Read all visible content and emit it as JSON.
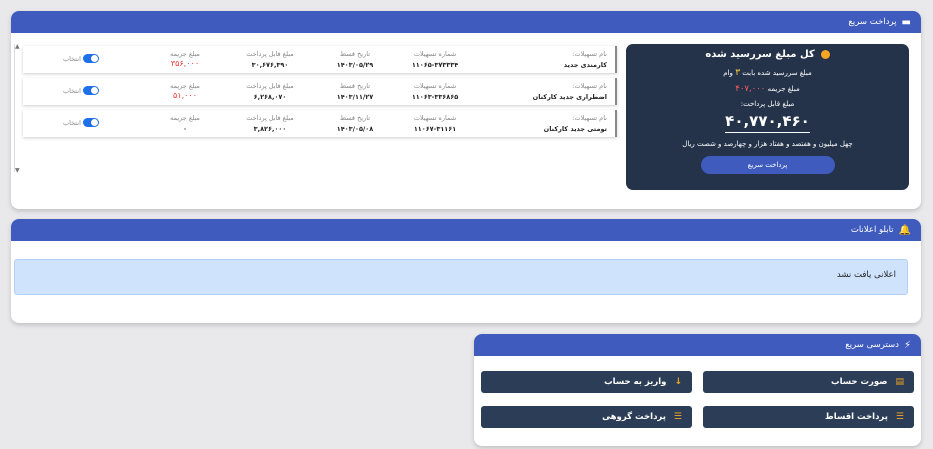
{
  "fast_payment": {
    "title": "پرداخت سریع",
    "summary": {
      "title": "کل مبلغ سررسید شده",
      "overdue_prefix": "مبلغ سررسید شده بابت",
      "overdue_count": "۳",
      "overdue_suffix": "وام",
      "fine_label": "مبلغ جریمه",
      "fine_amount": "۴۰۷,۰۰۰",
      "payable_label": "مبلغ قابل پرداخت:",
      "payable_amount": "۴۰,۷۷۰,۴۶۰",
      "amount_words": "چهل میلیون و هفتصد و هفتاد هزار و چهارصد و شصت ریال",
      "button": "پرداخت سریع"
    },
    "labels": {
      "name": "نام تسهیلات:",
      "number": "شماره تسهیلات",
      "date": "تاریخ قسط",
      "payable": "مبلغ قابل پرداخت",
      "fine": "مبلغ جریمه",
      "select": "انتخاب"
    },
    "loans": [
      {
        "name": "کارمندی جدید",
        "number": "۱۱۰۶۵-۳۷۳۳۳۴",
        "date": "۱۴۰۳/۰۵/۲۹",
        "payable": "۳۰,۶۷۶,۳۹۰",
        "fine": "۳۵۶,۰۰۰"
      },
      {
        "name": "اضطراری جدید کارکنان",
        "number": "۱۱۰۶۳-۳۳۶۸۶۵",
        "date": "۱۴۰۳/۱۱/۲۷",
        "payable": "۶,۲۶۸,۰۷۰",
        "fine": "۵۱,۰۰۰"
      },
      {
        "name": "تومتی جدید کارکنان",
        "number": "۱۱۰۶۷-۳۱۱۶۱",
        "date": "۱۴۰۳/۰۵/۰۸",
        "payable": "۳,۸۲۶,۰۰۰",
        "fine": "۰"
      }
    ]
  },
  "announcements": {
    "title": "تابلو اعلانات",
    "empty_text": "اعلانی یافت نشد"
  },
  "quick_access": {
    "title": "دسترسی سریع",
    "buttons": [
      {
        "label": "صورت حساب",
        "icon": "document-icon"
      },
      {
        "label": "واریز به حساب",
        "icon": "arrow-down-icon"
      },
      {
        "label": "پرداخت اقساط",
        "icon": "coins-icon"
      },
      {
        "label": "پرداخت گروهی",
        "icon": "coins-icon"
      }
    ]
  },
  "colors": {
    "header": "#3f5bbd",
    "summary_bg": "#243349",
    "button_dark": "#2c3e57",
    "accent": "#f5a623",
    "fine_red": "#e53935"
  }
}
